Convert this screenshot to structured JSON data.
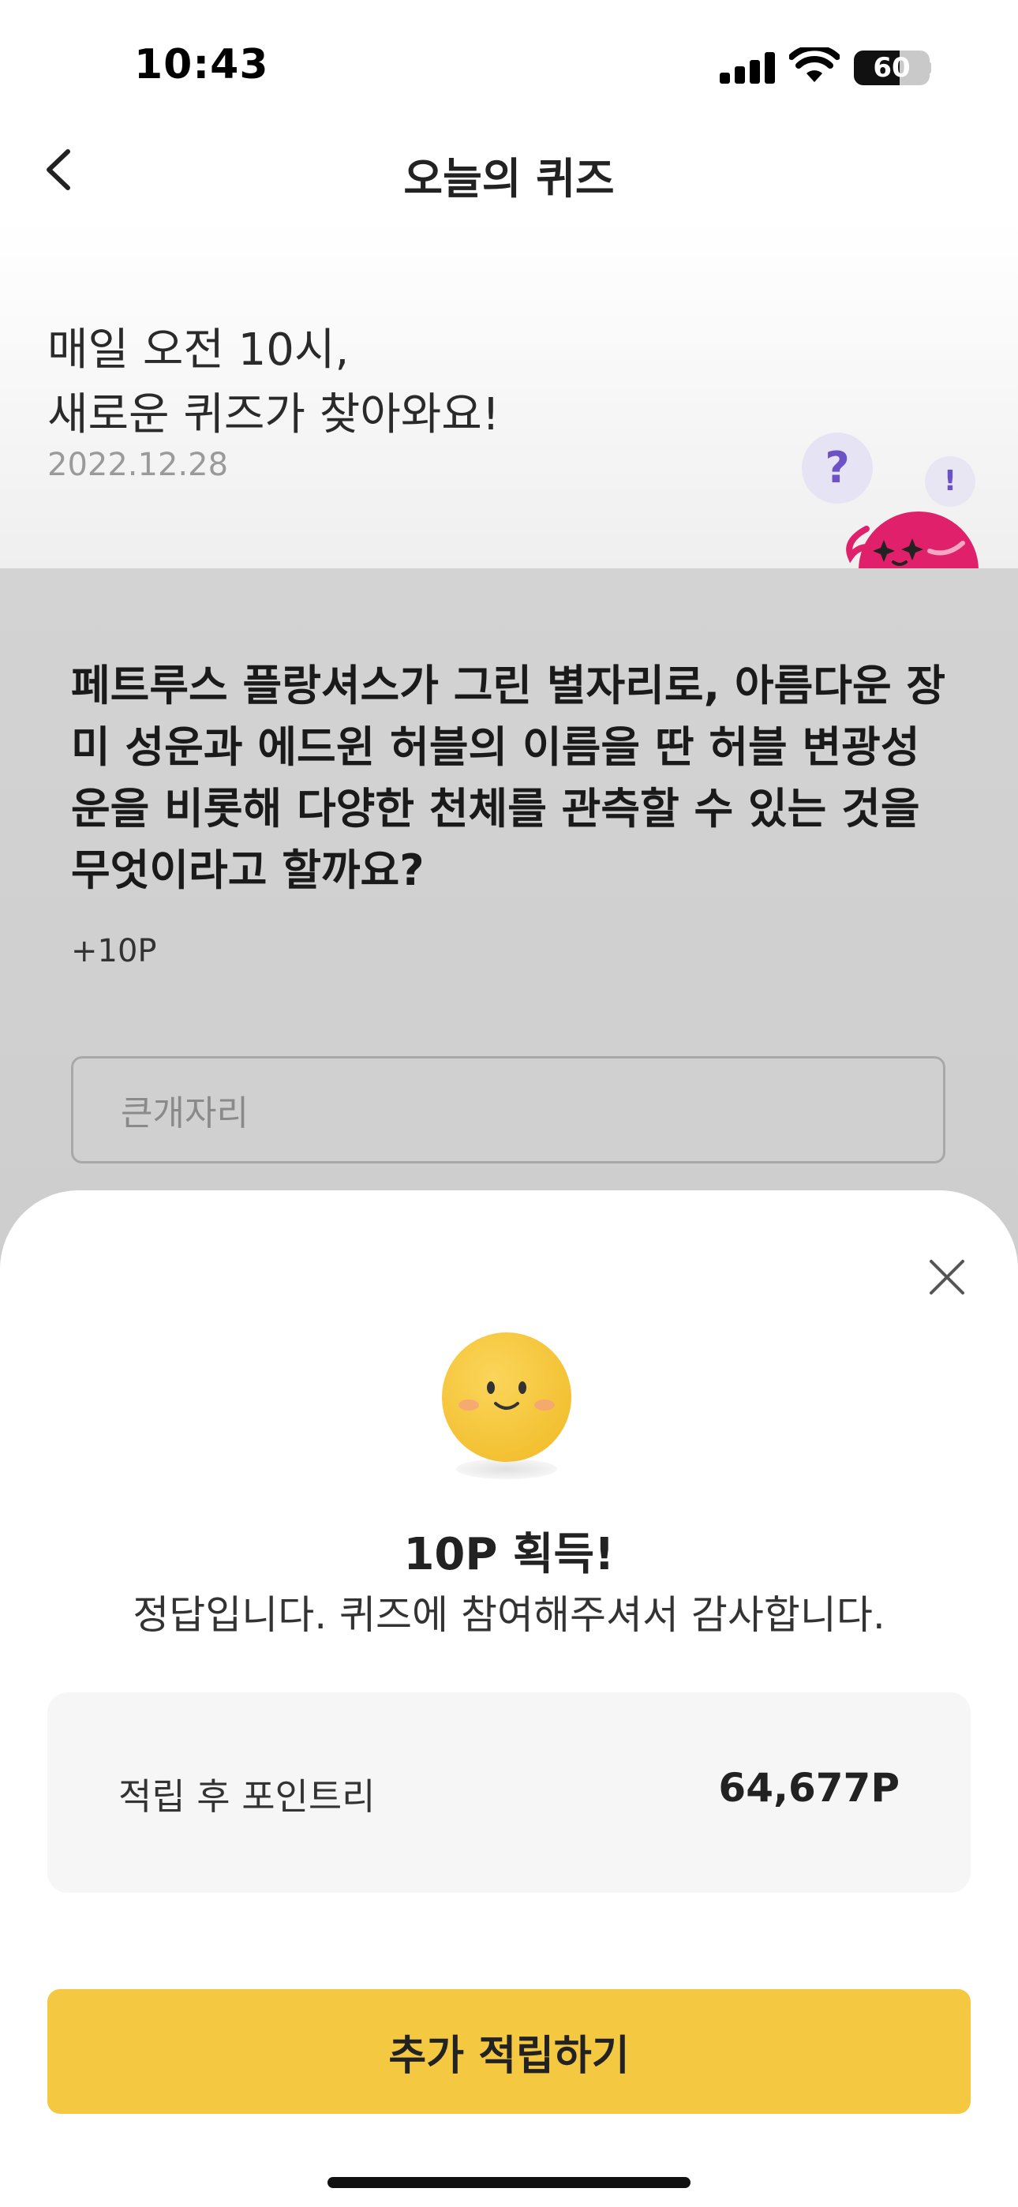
{
  "status_bar": {
    "time": "10:43",
    "battery_percent": 60
  },
  "nav": {
    "title": "오늘의 퀴즈"
  },
  "hero": {
    "line1": "매일 오전 10시,",
    "line2": "새로운 퀴즈가 찾아와요!",
    "date": "2022.12.28",
    "bubble_question": "?",
    "bubble_exclaim": "!"
  },
  "quiz": {
    "question": "페트루스 플랑셔스가 그린 별자리로, 아름다운 장미 성운과 에드윈 허블의 이름을 딴 허블 변광성운을 비롯해 다양한 천체를 관측할 수 있는 것을 무엇이라고 할까요?",
    "reward": "+10P",
    "answer_value": "큰개자리"
  },
  "result_sheet": {
    "title": "10P 획득!",
    "message": "정답입니다. 퀴즈에 참여해주셔서 감사합니다.",
    "points_label": "적립 후 포인트리",
    "points_value": "64,677P",
    "button_label": "추가 적립하기"
  },
  "colors": {
    "accent_yellow": "#F5C842",
    "mascot_pink": "#E0206A",
    "bubble_purple": "#6C52C6"
  },
  "icons": [
    "back-chevron-icon",
    "close-icon",
    "smiley-icon",
    "mascot-icon"
  ]
}
